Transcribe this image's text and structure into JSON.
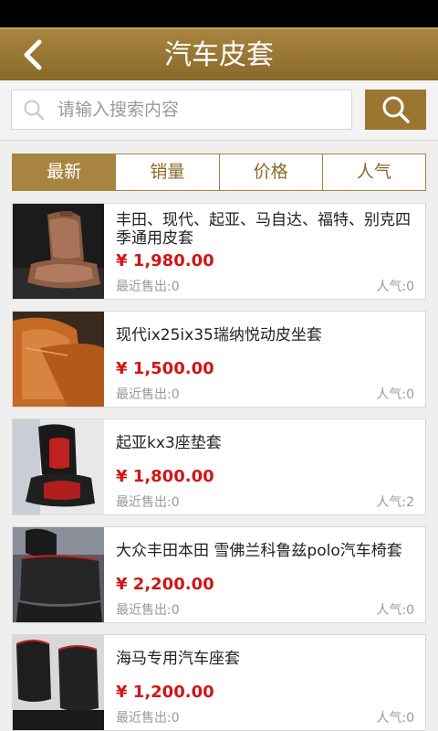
{
  "header": {
    "title": "汽车皮套"
  },
  "search": {
    "placeholder": "请输入搜索内容"
  },
  "tabs": [
    {
      "label": "最新",
      "active": true
    },
    {
      "label": "销量",
      "active": false
    },
    {
      "label": "价格",
      "active": false
    },
    {
      "label": "人气",
      "active": false
    }
  ],
  "products": [
    {
      "title": "丰田、现代、起亚、马自达、福特、别克四季通用皮套",
      "price": "¥ 1,980.00",
      "sold": "最近售出:0",
      "popularity": "人气:0"
    },
    {
      "title": "现代ix25ix35瑞纳悦动皮坐套",
      "price": "¥ 1,500.00",
      "sold": "最近售出:0",
      "popularity": "人气:0"
    },
    {
      "title": "起亚kx3座垫套",
      "price": "¥ 1,800.00",
      "sold": "最近售出:0",
      "popularity": "人气:2"
    },
    {
      "title": "大众丰田本田 雪佛兰科鲁兹polo汽车椅套",
      "price": "¥ 2,200.00",
      "sold": "最近售出:0",
      "popularity": "人气:0"
    },
    {
      "title": "海马专用汽车座套",
      "price": "¥ 1,200.00",
      "sold": "最近售出:0",
      "popularity": "人气:0"
    }
  ],
  "colors": {
    "brand": "#a88441",
    "price": "#d01616"
  },
  "icons": {
    "back": "chevron-left-icon",
    "search": "search-icon"
  }
}
